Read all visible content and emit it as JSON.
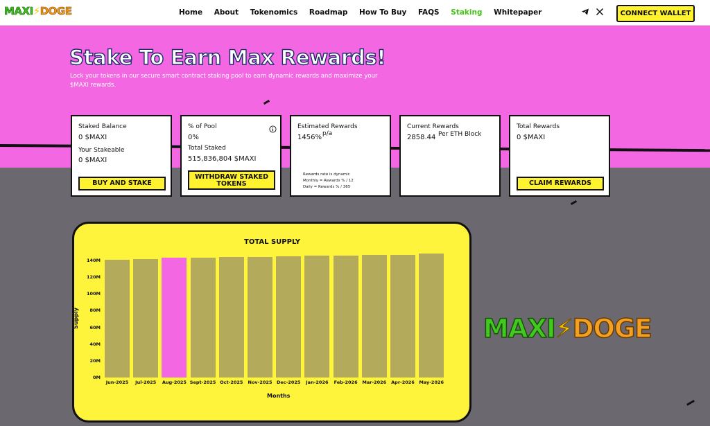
{
  "nav": {
    "logo": {
      "part1": "MAXI",
      "bolt": "⚡",
      "part2": "DOGE"
    },
    "links": [
      "Home",
      "About",
      "Tokenomics",
      "Roadmap",
      "How To Buy",
      "FAQS",
      "Staking",
      "Whitepaper"
    ],
    "active": "Staking",
    "wallet_button": "CONNECT WALLET",
    "accent": "#44c415"
  },
  "hero": {
    "title": "Stake To Earn Max Rewards!",
    "subtitle": "Lock your tokens in our secure smart contract staking pool to earn dynamic rewards and maximize your $MAXI rewards.",
    "bg_color": "#f467e3"
  },
  "cards": {
    "card1": {
      "staked_label": "Staked Balance",
      "staked_value": "0  $MAXI",
      "stakeable_label": "Your Stakeable",
      "stakeable_value": "0  $MAXI",
      "button": "BUY AND STAKE"
    },
    "card2": {
      "pool_label": "% of Pool",
      "pool_value": "0%",
      "total_label": "Total Staked",
      "total_value": "515,836,804 $MAXI",
      "button": "WITHDRAW STAKED TOKENS"
    },
    "card3": {
      "label": "Estimated Rewards",
      "value": "1456%",
      "unit": "p/a",
      "note1": "Rewards rate is dynamic",
      "note2": "Monthly = Rewards % / 12",
      "note3": "Daily = Rewards % / 365"
    },
    "card4": {
      "label": "Current Rewards",
      "value": "2858.44",
      "unit": "Per ETH Block"
    },
    "card5": {
      "label": "Total Rewards",
      "value": "0  $MAXI",
      "button": "CLAIM REWARDS"
    }
  },
  "chart_data": {
    "type": "bar",
    "title": "TOTAL SUPPLY",
    "xlabel": "Months",
    "ylabel": "Supply",
    "categories": [
      "Jun-2025",
      "Jul-2025",
      "Aug-2025",
      "Sept-2025",
      "Oct-2025",
      "Nov-2025",
      "Dec-2025",
      "Jan-2026",
      "Feb-2026",
      "Mar-2026",
      "Apr-2026",
      "May-2026"
    ],
    "values": [
      141000000,
      142000000,
      143000000,
      143500000,
      144000000,
      144500000,
      145000000,
      145500000,
      146000000,
      146500000,
      147000000,
      148000000
    ],
    "highlight_index": 2,
    "yticks": [
      "0M",
      "20M",
      "40M",
      "60M",
      "80M",
      "100M",
      "120M",
      "140M"
    ],
    "ylim": [
      0,
      140000000
    ],
    "bar_color": "#b4aa5c",
    "highlight_color": "#f467e3"
  },
  "brand_logo": {
    "part1": "MAXI",
    "bolt": "⚡",
    "part2": "DOGE"
  }
}
